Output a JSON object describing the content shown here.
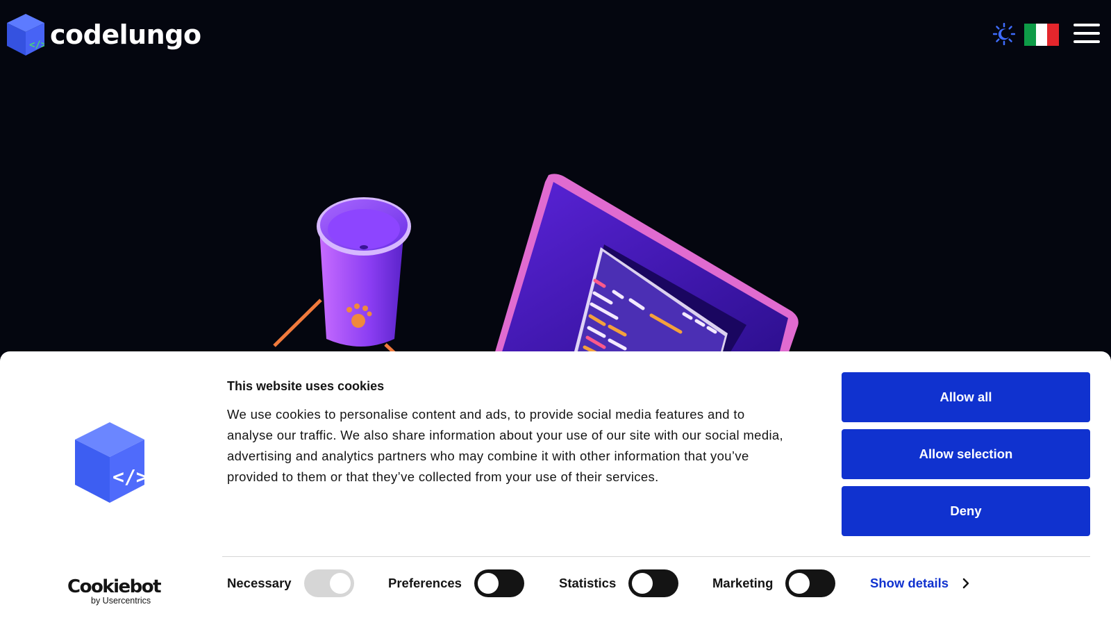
{
  "header": {
    "brand": "codelungo",
    "icons": {
      "logo": "cube-code-icon",
      "theme": "sun-moon-icon",
      "language": "italy-flag-icon",
      "menu": "hamburger-menu-icon"
    }
  },
  "hero": {
    "illustration": "isometric coffee cup and laptop illustration",
    "colors": {
      "purple": "#7b3cf0",
      "orange": "#f07a3c"
    }
  },
  "cookie_banner": {
    "title": "This website uses cookies",
    "description": "We use cookies to personalise content and ads, to provide social media features and to analyse our traffic. We also share information about your use of our site with our social media, advertising and analytics partners who may combine it with other information that you’ve provided to them or that they’ve collected from your use of their services.",
    "buttons": {
      "allow_all": "Allow all",
      "allow_selection": "Allow selection",
      "deny": "Deny"
    },
    "brand": {
      "name": "Cookiebot",
      "sub": "by Usercentrics"
    },
    "options": [
      {
        "label": "Necessary",
        "enabled": true,
        "locked": true
      },
      {
        "label": "Preferences",
        "enabled": false
      },
      {
        "label": "Statistics",
        "enabled": false
      },
      {
        "label": "Marketing",
        "enabled": false
      }
    ],
    "show_details": "Show details",
    "colors": {
      "accent": "#1032cf",
      "text": "#141414",
      "background": "#ffffff"
    }
  }
}
